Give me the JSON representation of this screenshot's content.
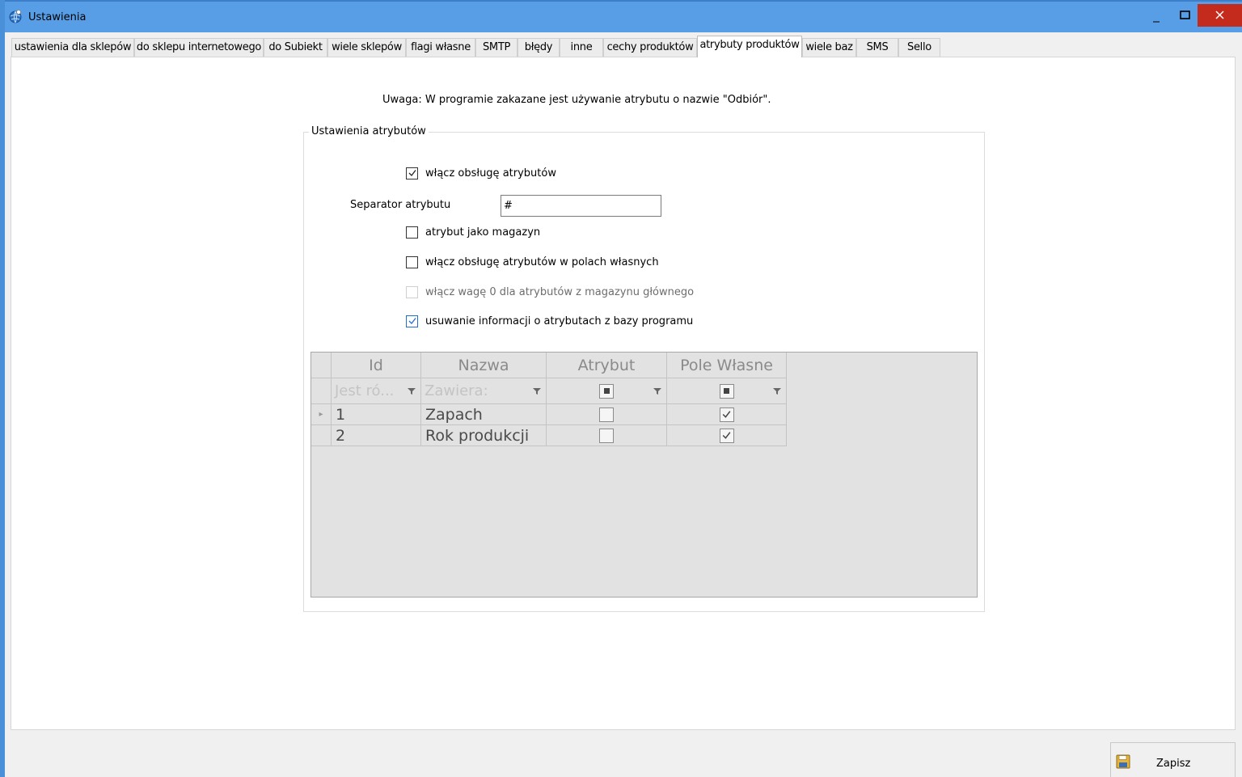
{
  "window": {
    "title": "Ustawienia",
    "min_glyph": "–",
    "max_glyph": "□",
    "close_glyph": "✕"
  },
  "tabs": [
    {
      "label": "ustawienia dla sklepów",
      "active": false
    },
    {
      "label": "do sklepu internetowego",
      "active": false
    },
    {
      "label": "do Subiekt",
      "active": false
    },
    {
      "label": "wiele sklepów",
      "active": false
    },
    {
      "label": "flagi własne",
      "active": false
    },
    {
      "label": "SMTP",
      "active": false
    },
    {
      "label": "błędy",
      "active": false
    },
    {
      "label": "inne",
      "active": false
    },
    {
      "label": "cechy produktów",
      "active": false
    },
    {
      "label": "atrybuty produktów",
      "active": true
    },
    {
      "label": "wiele baz",
      "active": false
    },
    {
      "label": "SMS",
      "active": false
    },
    {
      "label": "Sello",
      "active": false
    }
  ],
  "notice": "Uwaga: W programie zakazane jest używanie atrybutu o nazwie \"Odbiór\".",
  "group": {
    "legend": "Ustawienia atrybutów",
    "enable_attributes": {
      "label": "włącz obsługę atrybutów",
      "checked": true
    },
    "separator": {
      "label": "Separator atrybutu",
      "value": "#"
    },
    "attribute_as_warehouse": {
      "label": "atrybut jako magazyn",
      "checked": false
    },
    "enable_custom_fields": {
      "label": "włącz obsługę atrybutów w polach własnych",
      "checked": false
    },
    "zero_weight": {
      "label": "włącz wagę 0 dla atrybutów z magazynu głównego",
      "checked": false,
      "disabled": true
    },
    "remove_info": {
      "label": "usuwanie informacji o atrybutach z bazy programu",
      "checked": true
    }
  },
  "grid": {
    "columns": [
      "Id",
      "Nazwa",
      "Atrybut",
      "Pole Własne"
    ],
    "filters": {
      "id": "Jest ró...",
      "name": "Zawiera:"
    },
    "rows": [
      {
        "id": "1",
        "name": "Zapach",
        "atrybut": false,
        "pole_wlasne": true,
        "current": true
      },
      {
        "id": "2",
        "name": "Rok produkcji",
        "atrybut": false,
        "pole_wlasne": true,
        "current": false
      }
    ],
    "row_indicator": "▸"
  },
  "footer": {
    "save_label": "Zapisz"
  },
  "colors": {
    "titlebar": "#589ee6",
    "close": "#c42b1c",
    "check_blue": "#1f6fd1"
  }
}
